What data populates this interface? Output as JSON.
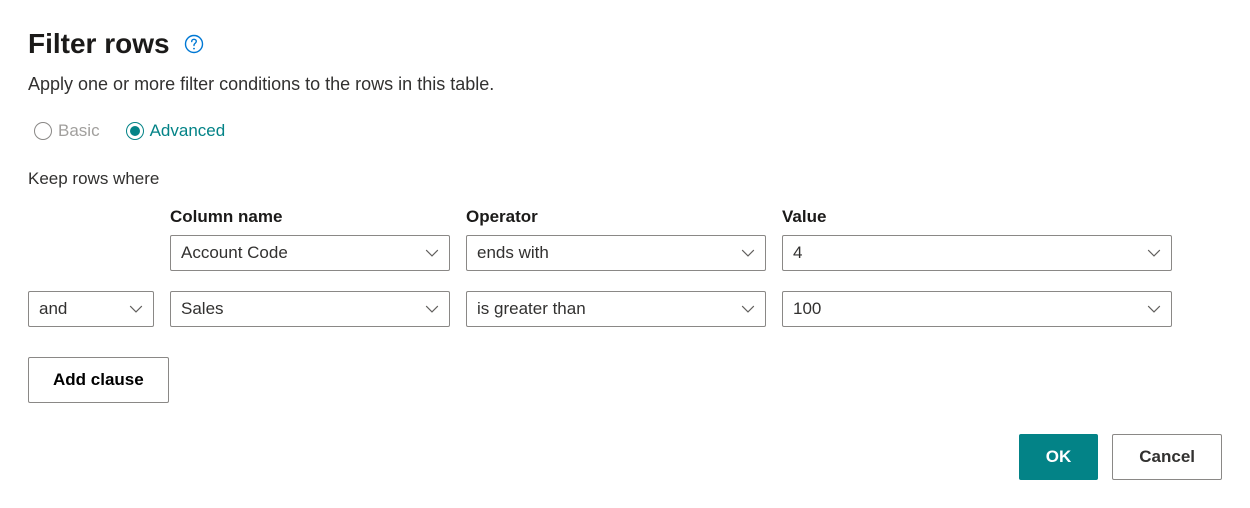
{
  "title": "Filter rows",
  "subtitle": "Apply one or more filter conditions to the rows in this table.",
  "mode": {
    "basic_label": "Basic",
    "advanced_label": "Advanced",
    "selected": "advanced"
  },
  "keep_label": "Keep rows where",
  "columns": {
    "column_header": "Column name",
    "operator_header": "Operator",
    "value_header": "Value"
  },
  "rows": [
    {
      "logic": "",
      "column": "Account Code",
      "operator": "ends with",
      "value": "4"
    },
    {
      "logic": "and",
      "column": "Sales",
      "operator": "is greater than",
      "value": "100"
    }
  ],
  "add_clause_label": "Add clause",
  "ok_label": "OK",
  "cancel_label": "Cancel"
}
